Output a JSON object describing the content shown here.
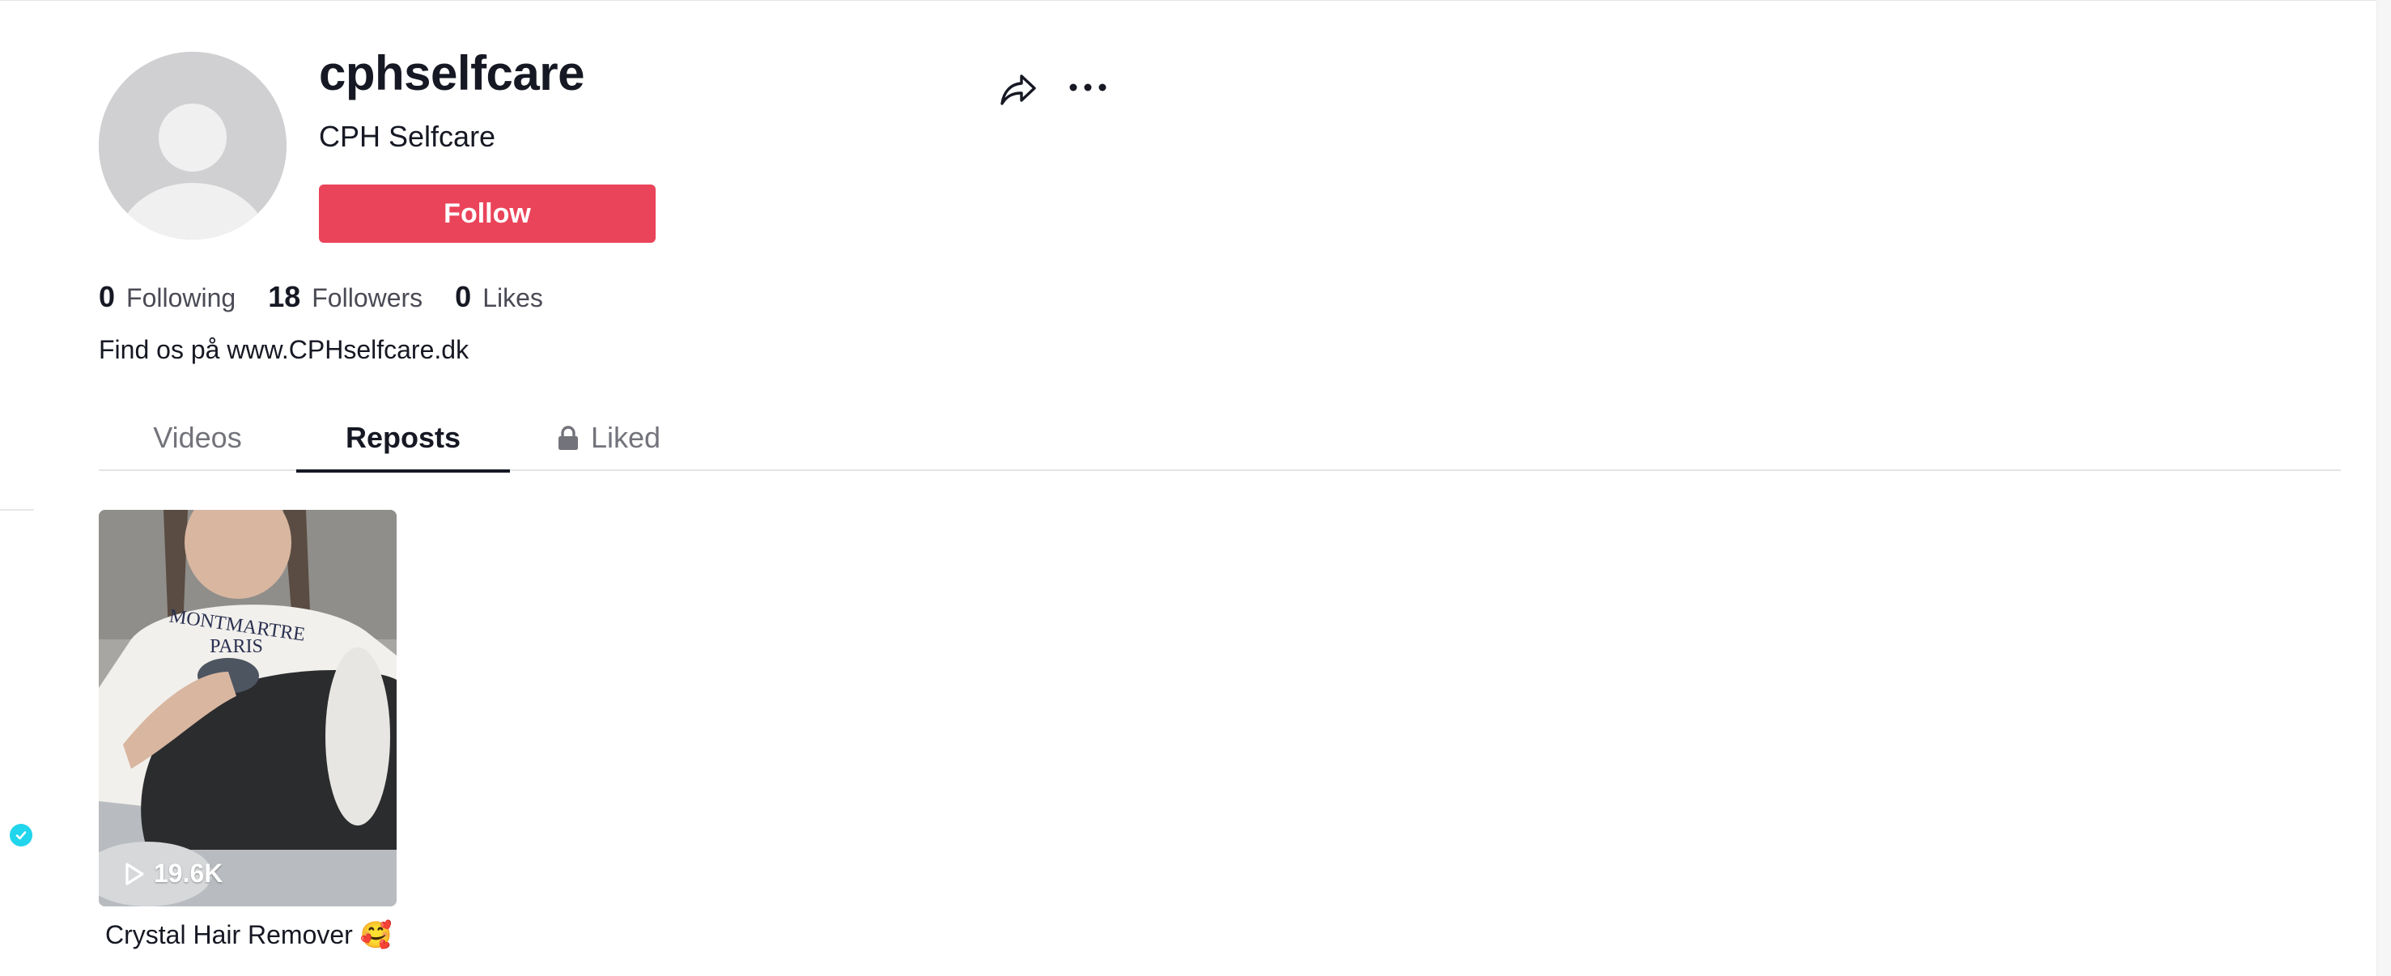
{
  "profile": {
    "username": "cphselfcare",
    "nickname": "CPH Selfcare",
    "follow_label": "Follow",
    "bio": "Find os på www.CPHselfcare.dk",
    "avatar_icon": "default-avatar-icon",
    "accent_color": "#ea445a"
  },
  "stats": {
    "following": {
      "value": "0",
      "label": "Following"
    },
    "followers": {
      "value": "18",
      "label": "Followers"
    },
    "likes": {
      "value": "0",
      "label": "Likes"
    }
  },
  "actions": {
    "share_icon": "share-icon",
    "more_icon": "more-icon"
  },
  "tabs": [
    {
      "label": "Videos",
      "active": false
    },
    {
      "label": "Reposts",
      "active": true
    },
    {
      "label": "Liked",
      "active": false,
      "icon": "lock-icon"
    }
  ],
  "videos": [
    {
      "views": "19.6K",
      "caption": "Crystal Hair Remover 🥰",
      "thumbnail_text": "MONTMARTRE PARIS"
    }
  ]
}
